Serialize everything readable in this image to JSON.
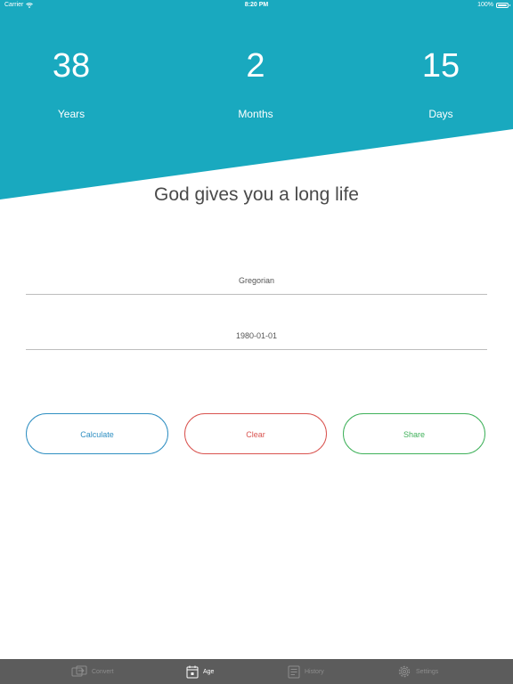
{
  "status_bar": {
    "carrier": "Carrier",
    "time": "8:20 PM",
    "battery": "100%"
  },
  "age": {
    "years_value": "38",
    "years_label": "Years",
    "months_value": "2",
    "months_label": "Months",
    "days_value": "15",
    "days_label": "Days"
  },
  "tagline": "God gives you a long life",
  "form": {
    "calendar_value": "Gregorian",
    "date_value": "1980-01-01"
  },
  "buttons": {
    "calculate_label": "Calculate",
    "clear_label": "Clear",
    "share_label": "Share"
  },
  "tabs": [
    {
      "label": "Convert",
      "icon": "convert-icon",
      "active": false
    },
    {
      "label": "Age",
      "icon": "calendar-icon",
      "active": true
    },
    {
      "label": "History",
      "icon": "history-icon",
      "active": false
    },
    {
      "label": "Settings",
      "icon": "gear-icon",
      "active": false
    }
  ],
  "colors": {
    "header": "#19a9bf",
    "calculate": "#2f8fc2",
    "clear": "#d9534f",
    "share": "#3fb15a",
    "tab_bar": "#5c5c5c"
  }
}
